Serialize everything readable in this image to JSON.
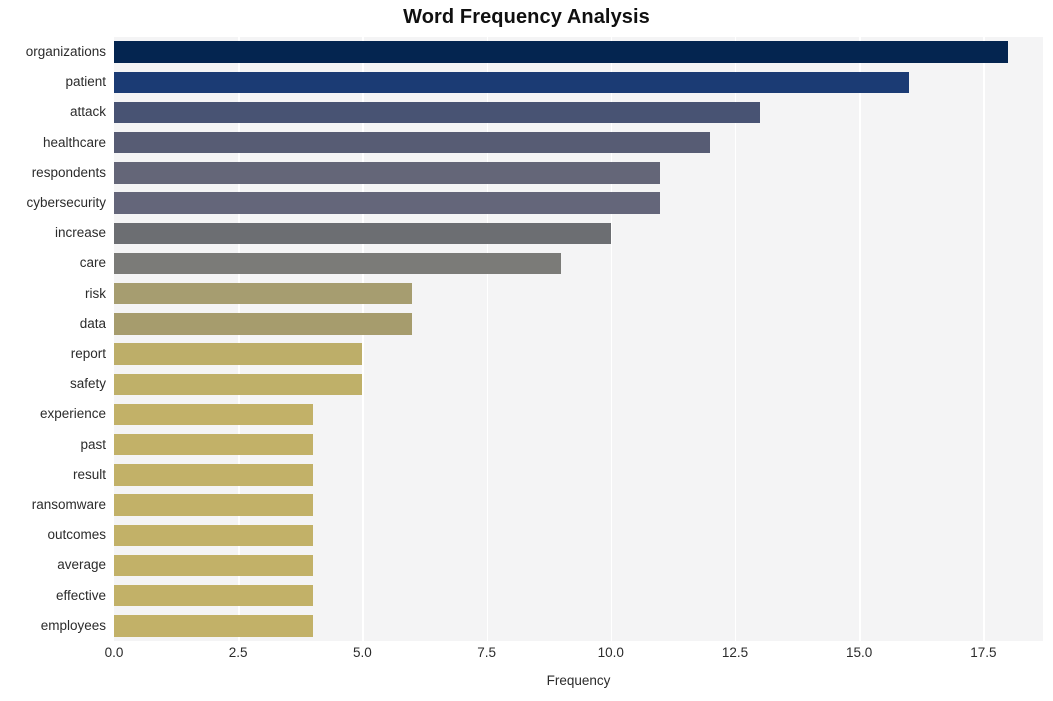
{
  "chart_data": {
    "type": "bar",
    "orientation": "horizontal",
    "title": "Word Frequency Analysis",
    "xlabel": "Frequency",
    "ylabel": "",
    "categories": [
      "organizations",
      "patient",
      "attack",
      "healthcare",
      "respondents",
      "cybersecurity",
      "increase",
      "care",
      "risk",
      "data",
      "report",
      "safety",
      "experience",
      "past",
      "result",
      "ransomware",
      "outcomes",
      "average",
      "effective",
      "employees"
    ],
    "values": [
      18,
      16,
      13,
      12,
      11,
      11,
      10,
      9,
      6,
      6,
      5,
      5,
      4,
      4,
      4,
      4,
      4,
      4,
      4,
      4
    ],
    "bar_colors": [
      "#042550",
      "#1b3b74",
      "#485373",
      "#575c74",
      "#646678",
      "#64667a",
      "#6c6e72",
      "#7b7b78",
      "#a69d70",
      "#a69c6d",
      "#bdae69",
      "#bfb069",
      "#c2b168",
      "#c2b168",
      "#c2b168",
      "#c2b168",
      "#c2b168",
      "#c2b168",
      "#c2b168",
      "#c2b168"
    ],
    "xlim": [
      0.0,
      18.7
    ],
    "xticks": [
      "0.0",
      "2.5",
      "5.0",
      "7.5",
      "10.0",
      "12.5",
      "15.0",
      "17.5"
    ],
    "xtick_values": [
      0.0,
      2.5,
      5.0,
      7.5,
      10.0,
      12.5,
      15.0,
      17.5
    ],
    "grid": true,
    "grid_color": "#ffffff",
    "plot_background": "#f4f4f5",
    "figure_background": "#ffffff",
    "legend": "none"
  }
}
